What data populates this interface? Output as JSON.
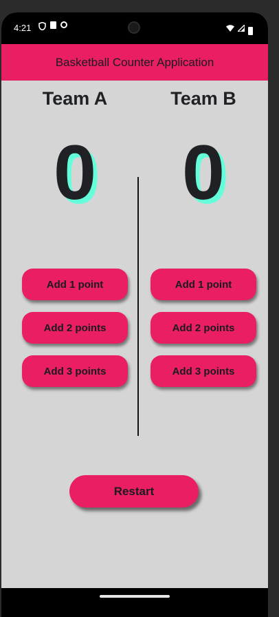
{
  "status_bar": {
    "time": "4:21"
  },
  "app_bar": {
    "title": "Basketball Counter Application"
  },
  "team_a": {
    "name": "Team A",
    "score": "0",
    "buttons": [
      "Add 1 point",
      "Add 2 points",
      "Add 3 points"
    ]
  },
  "team_b": {
    "name": "Team B",
    "score": "0",
    "buttons": [
      "Add 1 point",
      "Add 2 points",
      "Add 3 points"
    ]
  },
  "restart_label": "Restart",
  "colors": {
    "primary": "#e91e63",
    "background": "#d5d5d5",
    "score_shadow": "#64ffda",
    "text": "#1f2125"
  }
}
